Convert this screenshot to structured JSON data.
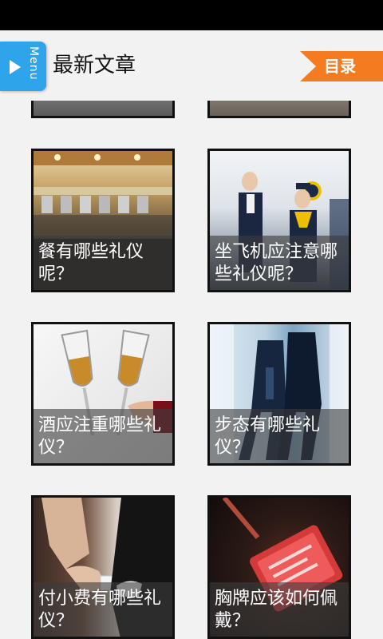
{
  "header": {
    "menu_label": "Menu",
    "title": "最新文章",
    "catalog_label": "目录"
  },
  "articles": [
    {
      "title": "",
      "image": "partial-image-top-left"
    },
    {
      "title": "",
      "image": "partial-image-top-right"
    },
    {
      "title": "餐有哪些礼仪呢？",
      "image": "restaurant-buffet"
    },
    {
      "title": "坐飞机应注意哪些礼仪呢？",
      "image": "flight-attendants"
    },
    {
      "title": "酒应注重哪些礼仪？",
      "image": "wine-glasses-toast"
    },
    {
      "title": "步态有哪些礼仪？",
      "image": "people-walking"
    },
    {
      "title": "付小费有哪些礼仪？",
      "image": "handing-tip"
    },
    {
      "title": "胸牌应该如何佩戴？",
      "image": "name-badge"
    }
  ],
  "colors": {
    "menu_button": "#2ea5ea",
    "catalog_button": "#f47b20",
    "background": "#f2f2f2"
  }
}
